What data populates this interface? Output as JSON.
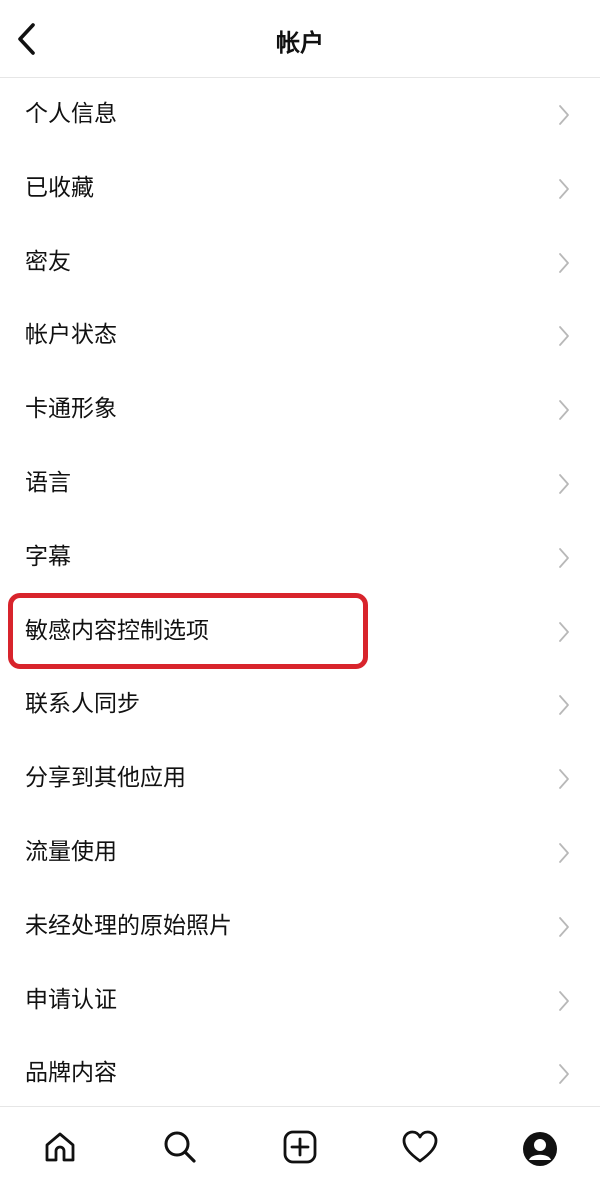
{
  "header": {
    "title": "帐户",
    "back_icon": "chevron-left-icon"
  },
  "menu": {
    "items": [
      {
        "label": "个人信息"
      },
      {
        "label": "已收藏"
      },
      {
        "label": "密友"
      },
      {
        "label": "帐户状态"
      },
      {
        "label": "卡通形象"
      },
      {
        "label": "语言"
      },
      {
        "label": "字幕"
      },
      {
        "label": "敏感内容控制选项",
        "highlighted": true
      },
      {
        "label": "联系人同步"
      },
      {
        "label": "分享到其他应用"
      },
      {
        "label": "流量使用"
      },
      {
        "label": "未经处理的原始照片"
      },
      {
        "label": "申请认证"
      },
      {
        "label": "品牌内容"
      }
    ],
    "chevron_icon": "chevron-right-icon"
  },
  "highlight_color": "#d8242c",
  "tabbar": {
    "tabs": [
      {
        "icon": "home-icon"
      },
      {
        "icon": "search-icon"
      },
      {
        "icon": "create-post-icon"
      },
      {
        "icon": "heart-icon"
      },
      {
        "icon": "profile-icon"
      }
    ]
  }
}
